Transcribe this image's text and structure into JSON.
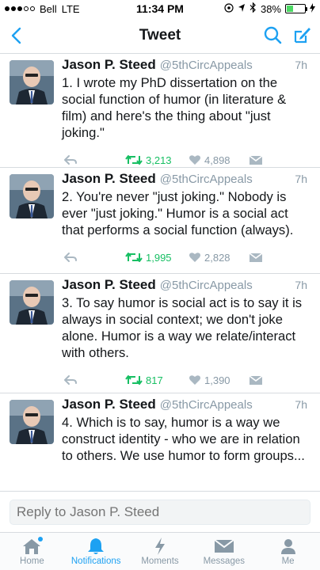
{
  "status_bar": {
    "carrier": "Bell",
    "network": "LTE",
    "time": "11:34 PM",
    "battery": "38%",
    "battery_level": 0.38
  },
  "nav": {
    "title": "Tweet"
  },
  "tweets": [
    {
      "author": "Jason P. Steed",
      "handle": "@5thCircAppeals",
      "time": "7h",
      "text": "1. I wrote my PhD dissertation on the social function of humor (in literature & film) and here's the thing about \"just joking.\"",
      "retweets": "3,213",
      "likes": "4,898"
    },
    {
      "author": "Jason P. Steed",
      "handle": "@5thCircAppeals",
      "time": "7h",
      "text": "2. You're never \"just joking.\" Nobody is ever \"just joking.\" Humor is a social act that performs a social function (always).",
      "retweets": "1,995",
      "likes": "2,828"
    },
    {
      "author": "Jason P. Steed",
      "handle": "@5thCircAppeals",
      "time": "7h",
      "text": "3. To say humor is social act is to say it is always in social context; we don't joke alone. Humor is a way we relate/interact with others.",
      "retweets": "817",
      "likes": "1,390"
    },
    {
      "author": "Jason P. Steed",
      "handle": "@5thCircAppeals",
      "time": "7h",
      "text": "4. Which is to say, humor is a way we construct identity - who we are in relation to others. We use humor to form groups...",
      "retweets": "",
      "likes": ""
    }
  ],
  "reply": {
    "placeholder": "Reply to Jason P. Steed"
  },
  "tabs": [
    {
      "label": "Home",
      "icon": "home-icon"
    },
    {
      "label": "Notifications",
      "icon": "bell-icon"
    },
    {
      "label": "Moments",
      "icon": "lightning-icon"
    },
    {
      "label": "Messages",
      "icon": "envelope-icon"
    },
    {
      "label": "Me",
      "icon": "person-icon"
    }
  ],
  "colors": {
    "accent": "#1da1f2",
    "retweet": "#17bf63",
    "muted": "#8899a6"
  }
}
